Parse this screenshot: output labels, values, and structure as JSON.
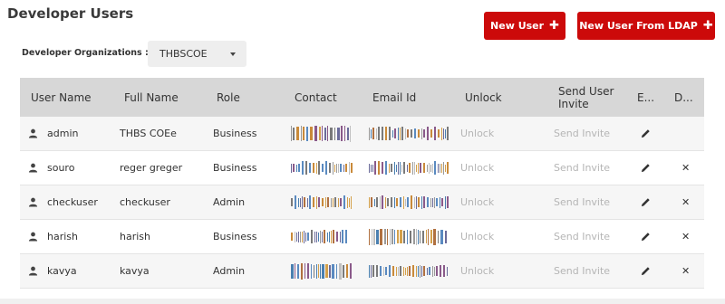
{
  "page": {
    "title": "Developer Users"
  },
  "toolbar": {
    "new_user_label": "New User",
    "new_ldap_label": "New User From LDAP",
    "plus_glyph": "✚"
  },
  "filter": {
    "org_label": "Developer Organizations :",
    "required_mark": "*",
    "org_selected": "THBSCOE"
  },
  "colors": {
    "accent": "#cc0a0a",
    "header_bg": "#d7d7d7"
  },
  "table": {
    "headers": [
      "User Name",
      "Full Name",
      "Role",
      "Contact",
      "Email Id",
      "Unlock",
      "Send User Invite",
      "E...",
      "D..."
    ],
    "rows": [
      {
        "username": "admin",
        "fullname": "THBS COEe",
        "role": "Business",
        "contact": "[redacted]",
        "email": "[redacted]",
        "unlock": "Unlock",
        "invite": "Send Invite",
        "editable": true,
        "deletable": false
      },
      {
        "username": "souro",
        "fullname": "reger greger",
        "role": "Business",
        "contact": "[redacted]",
        "email": "[redacted]",
        "unlock": "Unlock",
        "invite": "Send Invite",
        "editable": true,
        "deletable": true
      },
      {
        "username": "checkuser",
        "fullname": "checkuser",
        "role": "Admin",
        "contact": "[redacted]",
        "email": "[redacted]",
        "unlock": "Unlock",
        "invite": "Send Invite",
        "editable": true,
        "deletable": true
      },
      {
        "username": "harish",
        "fullname": "harish",
        "role": "Business",
        "contact": "[redacted]",
        "email": "[redacted]",
        "unlock": "Unlock",
        "invite": "Send Invite",
        "editable": true,
        "deletable": true
      },
      {
        "username": "kavya",
        "fullname": "kavya",
        "role": "Admin",
        "contact": "[redacted]",
        "email": "[redacted]",
        "unlock": "Unlock",
        "invite": "Send Invite",
        "editable": true,
        "deletable": true
      }
    ],
    "icons": {
      "user": "user-icon",
      "edit": "pencil-icon",
      "delete": "close-icon",
      "delete_glyph": "✕"
    }
  }
}
